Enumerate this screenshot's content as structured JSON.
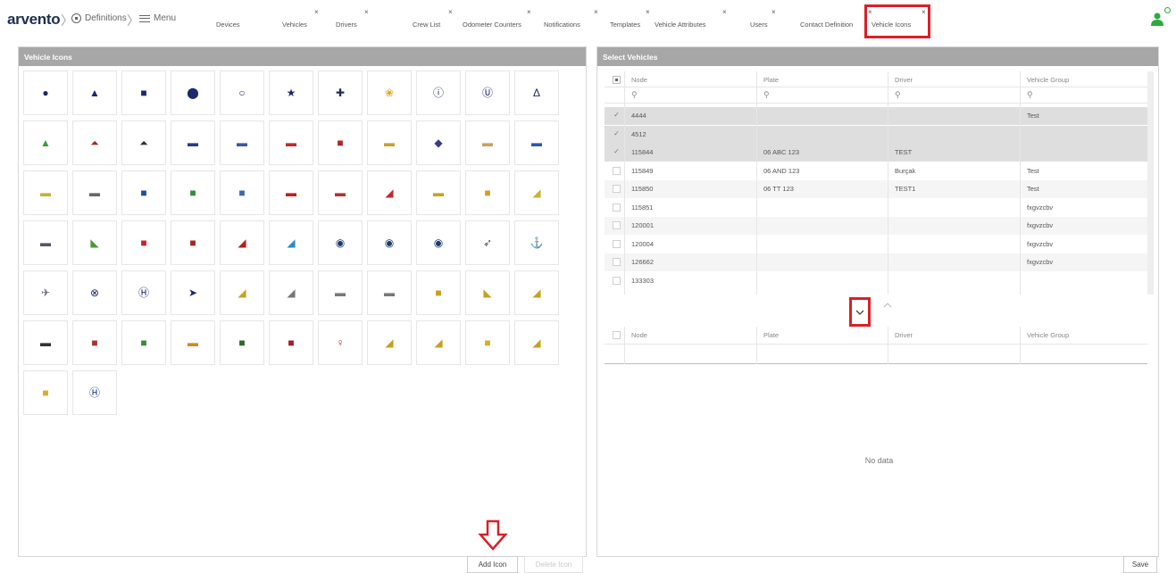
{
  "header": {
    "logo": "arvento",
    "breadcrumb_definitions": "Definitions",
    "breadcrumb_menu": "Menu",
    "tabs": [
      {
        "label": "Devices",
        "closable": false
      },
      {
        "label": "Vehicles",
        "closable": true
      },
      {
        "label": "Drivers",
        "closable": true
      },
      {
        "label": "Crew List",
        "closable": true
      },
      {
        "label": "Odometer Counters",
        "closable": true
      },
      {
        "label": "Notifications",
        "closable": true
      },
      {
        "label": "Templates",
        "closable": true
      },
      {
        "label": "Vehicle Attributes",
        "closable": true
      },
      {
        "label": "Users",
        "closable": true
      },
      {
        "label": "Contact Definition",
        "closable": true
      },
      {
        "label": "Vehicle Icons",
        "closable": true,
        "active": true
      }
    ],
    "close_glyph": "×",
    "highlight_color": "#d92027",
    "user_status_color": "#2eaa3f"
  },
  "vehicle_icons_panel": {
    "title": "Vehicle Icons",
    "icons": [
      {
        "name": "dot-icon",
        "glyph": "●",
        "color": "#1c2a6b"
      },
      {
        "name": "triangle-icon",
        "glyph": "▲",
        "color": "#1c2a6b"
      },
      {
        "name": "square-icon",
        "glyph": "■",
        "color": "#1c2a6b"
      },
      {
        "name": "circle-icon",
        "glyph": "⬤",
        "color": "#1c2a6b"
      },
      {
        "name": "ring-icon",
        "glyph": "○",
        "color": "#1c2a6b"
      },
      {
        "name": "star-icon",
        "glyph": "★",
        "color": "#1c2a6b"
      },
      {
        "name": "globe-icon",
        "glyph": "✚",
        "color": "#1c2a6b"
      },
      {
        "name": "hexagons-icon",
        "glyph": "❀",
        "color": "#e6a22a"
      },
      {
        "name": "info-circle-icon",
        "glyph": "ⓘ",
        "color": "#1c2a6b"
      },
      {
        "name": "u-circle-icon",
        "glyph": "Ⓤ",
        "color": "#1c2a6b"
      },
      {
        "name": "delta-icon",
        "glyph": "Δ",
        "color": "#1c2a6b"
      },
      {
        "name": "green-tree-icon",
        "glyph": "▲",
        "color": "#3b9c3a"
      },
      {
        "name": "red-helmet-icon",
        "glyph": "⏶",
        "color": "#a02a25"
      },
      {
        "name": "mound-icon",
        "glyph": "⏶",
        "color": "#2c3140"
      },
      {
        "name": "blue-car-icon",
        "glyph": "▬",
        "color": "#283b8a"
      },
      {
        "name": "sedan-icon",
        "glyph": "▬",
        "color": "#3a5aa0"
      },
      {
        "name": "red-car-icon",
        "glyph": "▬",
        "color": "#c02a2a"
      },
      {
        "name": "red-van-icon",
        "glyph": "■",
        "color": "#b02828"
      },
      {
        "name": "yellow-car-icon",
        "glyph": "▬",
        "color": "#c8a030"
      },
      {
        "name": "motorcycle-icon",
        "glyph": "◆",
        "color": "#3a3a8a"
      },
      {
        "name": "small-car-icon",
        "glyph": "▬",
        "color": "#c8a060"
      },
      {
        "name": "blue-sportscar-icon",
        "glyph": "▬",
        "color": "#2a5ab0"
      },
      {
        "name": "taxi-icon",
        "glyph": "▬",
        "color": "#c8b030"
      },
      {
        "name": "white-van-icon",
        "glyph": "▬",
        "color": "#666"
      },
      {
        "name": "blue-truck-icon",
        "glyph": "■",
        "color": "#2050a0"
      },
      {
        "name": "green-truck-icon",
        "glyph": "■",
        "color": "#3a8a3a"
      },
      {
        "name": "blue-lorry-icon",
        "glyph": "■",
        "color": "#3a6ab0"
      },
      {
        "name": "fire-truck-icon",
        "glyph": "▬",
        "color": "#c02020"
      },
      {
        "name": "red-bus-icon",
        "glyph": "▬",
        "color": "#b83030"
      },
      {
        "name": "crane-icon",
        "glyph": "◢",
        "color": "#c02a2a"
      },
      {
        "name": "yellow-truck-icon",
        "glyph": "▬",
        "color": "#d0a020"
      },
      {
        "name": "dump-truck-icon",
        "glyph": "■",
        "color": "#d0a020"
      },
      {
        "name": "excavator-icon",
        "glyph": "◢",
        "color": "#d0b030"
      },
      {
        "name": "tractor-icon",
        "glyph": "▬",
        "color": "#556"
      },
      {
        "name": "green-tractor-icon",
        "glyph": "◣",
        "color": "#4a9a30"
      },
      {
        "name": "red-tractor-icon",
        "glyph": "■",
        "color": "#c02828"
      },
      {
        "name": "red-jeep-icon",
        "glyph": "■",
        "color": "#b02020"
      },
      {
        "name": "red-snowmobile-icon",
        "glyph": "◢",
        "color": "#b02020"
      },
      {
        "name": "boat-icon",
        "glyph": "◢",
        "color": "#2a8ad0"
      },
      {
        "name": "ship-circle-icon",
        "glyph": "◉",
        "color": "#1c3a6b"
      },
      {
        "name": "ferry-circle-icon",
        "glyph": "◉",
        "color": "#1c3a6b"
      },
      {
        "name": "boat-circle-icon",
        "glyph": "◉",
        "color": "#1c3a6b"
      },
      {
        "name": "jet-icon",
        "glyph": "➶",
        "color": "#555"
      },
      {
        "name": "anchor-icon",
        "glyph": "⚓",
        "color": "#555"
      },
      {
        "name": "helicopter-icon",
        "glyph": "✈",
        "color": "#667"
      },
      {
        "name": "no-entry-icon",
        "glyph": "⊗",
        "color": "#1c2a6b"
      },
      {
        "name": "h-circle-icon",
        "glyph": "Ⓗ",
        "color": "#1c2a6b"
      },
      {
        "name": "chevron-right-icon",
        "glyph": "➤",
        "color": "#1c2a6b"
      },
      {
        "name": "grader-icon",
        "glyph": "◢",
        "color": "#c8a020"
      },
      {
        "name": "crane-truck-icon",
        "glyph": "◢",
        "color": "#777"
      },
      {
        "name": "tow-truck-icon",
        "glyph": "▬",
        "color": "#777"
      },
      {
        "name": "trailer-icon",
        "glyph": "▬",
        "color": "#777"
      },
      {
        "name": "roller-icon",
        "glyph": "■",
        "color": "#c8a020"
      },
      {
        "name": "tower-crane-icon",
        "glyph": "◣",
        "color": "#c8a020"
      },
      {
        "name": "loader-icon",
        "glyph": "◢",
        "color": "#c8a020"
      },
      {
        "name": "black-car-icon",
        "glyph": "▬",
        "color": "#333"
      },
      {
        "name": "tram-icon",
        "glyph": "■",
        "color": "#b03030"
      },
      {
        "name": "garbage-truck-icon",
        "glyph": "■",
        "color": "#3a8a3a"
      },
      {
        "name": "school-bus-icon",
        "glyph": "▬",
        "color": "#d08a20"
      },
      {
        "name": "green-farm-tractor-icon",
        "glyph": "■",
        "color": "#2a6a2a"
      },
      {
        "name": "red-farm-tractor-icon",
        "glyph": "■",
        "color": "#a02020"
      },
      {
        "name": "worker-icon",
        "glyph": "♀",
        "color": "#b03030"
      },
      {
        "name": "bulldozer-icon",
        "glyph": "◢",
        "color": "#c8a020"
      },
      {
        "name": "backhoe-icon",
        "glyph": "◢",
        "color": "#c8a020"
      },
      {
        "name": "skid-loader-icon",
        "glyph": "■",
        "color": "#d8b020"
      },
      {
        "name": "digger-icon",
        "glyph": "◢",
        "color": "#c8a020"
      },
      {
        "name": "mining-truck-icon",
        "glyph": "■",
        "color": "#d8b020"
      },
      {
        "name": "h-badge-icon",
        "glyph": "Ⓗ",
        "color": "#1c3a8a"
      }
    ],
    "add_icon_label": "Add Icon",
    "delete_icon_label": "Delete Icon"
  },
  "select_vehicles_panel": {
    "title": "Select Vehicles",
    "columns": [
      "Node",
      "Plate",
      "Driver",
      "Vehicle Group"
    ],
    "search_glyph": "⚲",
    "rows": [
      {
        "node": "4444",
        "plate": "",
        "driver": "",
        "group": "Test",
        "checked": true
      },
      {
        "node": "4512",
        "plate": "",
        "driver": "",
        "group": "",
        "checked": true
      },
      {
        "node": "115844",
        "plate": "06 ABC 123",
        "driver": "TEST",
        "group": "",
        "checked": true
      },
      {
        "node": "115849",
        "plate": "06 AND 123",
        "driver": "Burçak",
        "group": "Test",
        "checked": false
      },
      {
        "node": "115850",
        "plate": "06 TT 123",
        "driver": "TEST1",
        "group": "Test",
        "checked": false
      },
      {
        "node": "115851",
        "plate": "",
        "driver": "",
        "group": "fxgvzcbv",
        "checked": false
      },
      {
        "node": "120001",
        "plate": "",
        "driver": "",
        "group": "fxgvzcbv",
        "checked": false
      },
      {
        "node": "120004",
        "plate": "",
        "driver": "",
        "group": "fxgvzcbv",
        "checked": false
      },
      {
        "node": "126662",
        "plate": "",
        "driver": "",
        "group": "fxgvzcbv",
        "checked": false
      },
      {
        "node": "133303",
        "plate": "",
        "driver": "",
        "group": "",
        "checked": false
      }
    ],
    "check_glyph": "✓",
    "move_down_glyph": "⌄",
    "move_up_glyph": "⌃",
    "selected_columns": [
      "Node",
      "Plate",
      "Driver",
      "Vehicle Group"
    ],
    "no_data": "No data",
    "save_label": "Save"
  }
}
